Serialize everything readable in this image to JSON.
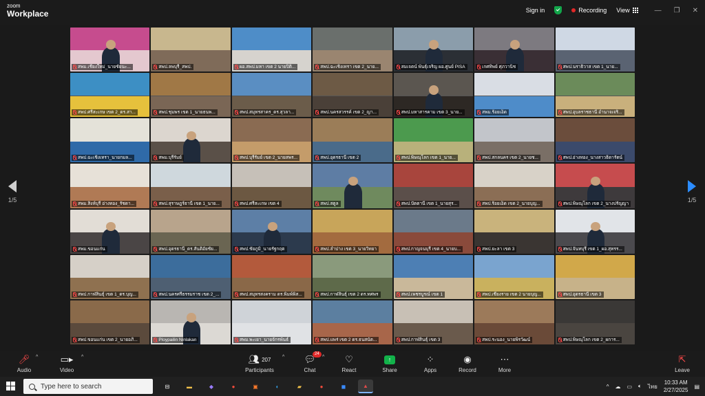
{
  "app": {
    "logo_line1": "zoom",
    "logo_line2": "Workplace"
  },
  "topbar": {
    "signin": "Sign in",
    "recording": "Recording",
    "view": "View"
  },
  "pager": {
    "left": "1/5",
    "right": "1/5"
  },
  "tiles": [
    {
      "name": "สพม.เชียงใหม่_นายชัยนะ...",
      "top": "#c64c8e",
      "bot": "#e4c8cf",
      "person": true
    },
    {
      "name": "สพป.ลพบุรี_สพป.",
      "top": "#c8b78e",
      "bot": "#7f6b59",
      "person": false
    },
    {
      "name": "ผอ.สพป.มหา เขต 2 นายปิติ...",
      "top": "#4e8dc8",
      "bot": "#d6d3ce",
      "person": false
    },
    {
      "name": "สพป.ฉะเชิงเทรา เขต 2_นาย...",
      "top": "#6a6f6c",
      "bot": "#9a8570",
      "person": false
    },
    {
      "name": "สมเจตน์ พันธุ์เจริญ ผอ.ศูนย์ PISA",
      "top": "#8b9dab",
      "bot": "#2b2f35",
      "person": true,
      "active": true
    },
    {
      "name": "เกศทิพย์ ศุภวานิช",
      "top": "#7d7a80",
      "bot": "#3a2f35",
      "person": true
    },
    {
      "name": "สพป.นราธิวาส เขต 1_นาย...",
      "top": "#cfd8e4",
      "bot": "#5a6372",
      "person": false
    },
    {
      "name": "สพป.ศรีสะเกษ เขต 2_ดร.สา...",
      "top": "#3d8fc4",
      "bot": "#e6c13c",
      "person": false
    },
    {
      "name": "สพป.ชุมพร เขต 1_นายธนพ...",
      "top": "#a07846",
      "bot": "#7a6655",
      "person": false
    },
    {
      "name": "สพป.สมุทรสาคร_ดร.สุวลา...",
      "top": "#5a8ec2",
      "bot": "#6b5c4a",
      "person": false
    },
    {
      "name": "สพป.นครสวรรค์ เขต 2_ญา...",
      "top": "#6d5a45",
      "bot": "#4a4038",
      "person": false
    },
    {
      "name": "สพป.มหาสารคาม เขต 3_นาย...",
      "top": "#5b5650",
      "bot": "#2d2824",
      "person": true
    },
    {
      "name": "สพม.ร้อยเอ็ด",
      "top": "#d9dde4",
      "bot": "#4e8cc9",
      "person": false
    },
    {
      "name": "สพป.อุบลราชธานี อำนาจเจริ...",
      "top": "#6b8b5a",
      "bot": "#c9b07c",
      "person": false
    },
    {
      "name": "สพป.ฉะเชิงเทรา_นายกมล...",
      "top": "#e4e2d9",
      "bot": "#2f6aa8",
      "person": false
    },
    {
      "name": "สพม.บุรีรัมย์",
      "top": "#dcd6cf",
      "bot": "#5a5048",
      "person": true
    },
    {
      "name": "สพป.บุรีรัมย์ เขต 2_นายสพร...",
      "top": "#8a6b52",
      "bot": "#c49c6a",
      "person": false
    },
    {
      "name": "สพป.อุดรธานี เขต 2",
      "top": "#9b7d58",
      "bot": "#4a6b8a",
      "person": false
    },
    {
      "name": "สพป.พิษณุโลก เขต 1_นาย...",
      "top": "#4c9a4e",
      "bot": "#b8b17b",
      "person": false
    },
    {
      "name": "สพป.สกลนคร เขต 2_นายช...",
      "top": "#c2c5ca",
      "bot": "#7a6f66",
      "person": false
    },
    {
      "name": "สพป.อ่างทอง_นางสาวธิดารัตน์",
      "top": "#6b4d3c",
      "bot": "#3b4a6b",
      "person": false
    },
    {
      "name": "สพม.สิงห์บุรี อ่างทอง_รัชดา...",
      "top": "#e7e1d8",
      "bot": "#b07a55",
      "person": false
    },
    {
      "name": "สพป.สุราษฎร์ธานี เขต 1_นาย...",
      "top": "#cfd8dd",
      "bot": "#7a5f4a",
      "person": false
    },
    {
      "name": "สพป.ศรีสะเกษ เขต 4",
      "top": "#c6c0b8",
      "bot": "#6c5842",
      "person": false
    },
    {
      "name": "สพป.สตูล",
      "top": "#5e7da4",
      "bot": "#6f8a5e",
      "person": true
    },
    {
      "name": "สพป.ปัตตานี เขต 1_นายสุร...",
      "top": "#a8453d",
      "bot": "#5b4f4a",
      "person": false
    },
    {
      "name": "สพป.ร้อยเอ็ด เขต 2_นายบุญ...",
      "top": "#d8d2c8",
      "bot": "#8b6e55",
      "person": false
    },
    {
      "name": "สพป.พิษณุโลก เขต 2_นางปรัญญา",
      "top": "#c64c4e",
      "bot": "#3e3a3c",
      "person": true
    },
    {
      "name": "สพม.ขอนแก่น",
      "top": "#e2ddd6",
      "bot": "#4a4545",
      "person": true
    },
    {
      "name": "สพป.อุดรธานี_ดร.สันติอัยชัย...",
      "top": "#b8a48c",
      "bot": "#6a6552",
      "person": false
    },
    {
      "name": "สพป.ชัยภูมิ_นายรัฐกฤต",
      "top": "#5d7fa6",
      "bot": "#2c3a4d",
      "person": true
    },
    {
      "name": "สพป.ลำปาง เขต 3_นายวิทยา",
      "top": "#c8a55a",
      "bot": "#a36b3f",
      "person": false
    },
    {
      "name": "สพป.กาญจนบุรี เขต 4_นายบ...",
      "top": "#6b7a8a",
      "bot": "#8a4a3b",
      "person": false
    },
    {
      "name": "สพป.ยะลา เขต 3",
      "top": "#c9b37c",
      "bot": "#3a3532",
      "person": false
    },
    {
      "name": "สพป.จันทบุรี เขต 1_ผอ.สุทรร...",
      "top": "#e1e4e8",
      "bot": "#4b4a4e",
      "person": true
    },
    {
      "name": "สพป.กาฬสินธุ์ เขต 1_ดร.บุญ...",
      "top": "#d6d0c8",
      "bot": "#8f7150",
      "person": false
    },
    {
      "name": "สพป.นครศรีธรรมราช เขต 2_...",
      "top": "#3c6d9c",
      "bot": "#4e5f72",
      "person": false
    },
    {
      "name": "สพป.สมุทรสงคราม ดร.พิมพ์พิส...",
      "top": "#b35a3c",
      "bot": "#8a6848",
      "person": false
    },
    {
      "name": "สพป.กาฬสินธุ์ เขต 2 ดร.ทศพร",
      "top": "#8a9a7c",
      "bot": "#5e6a4a",
      "person": false
    },
    {
      "name": "สพป.เพชรบูรณ์ เขต 1",
      "top": "#4d7fb4",
      "bot": "#c9b89a",
      "person": false
    },
    {
      "name": "สพป.เชียงราย เขต 2 นายบุญ...",
      "top": "#7aa4cf",
      "bot": "#c9b15e",
      "person": false
    },
    {
      "name": "สพป.อุดรธานี เขต 3",
      "top": "#d1a84a",
      "bot": "#c7b289",
      "person": false
    },
    {
      "name": "สพป.ขอนแก่น เขต 2_นายอภิ...",
      "top": "#8a6a4a",
      "bot": "#5b4a3c",
      "person": false
    },
    {
      "name": "Ploypailin Ninlakan",
      "top": "#b9b6b2",
      "bot": "#dcd9d4",
      "person": true
    },
    {
      "name": "สพม.พะเยา_นายจักรพันธ์",
      "top": "#cfd3d8",
      "bot": "#e0e2e5",
      "person": false
    },
    {
      "name": "สพป.แพร่ เขต 2 ดร.ธนสนัต...",
      "top": "#5c7fa0",
      "bot": "#a8664a",
      "person": false
    },
    {
      "name": "สพป.กาฬสินธุ์ เขต 3",
      "top": "#c8c0b5",
      "bot": "#6a5a4c",
      "person": false
    },
    {
      "name": "สพป.ระนอง_นายพิรวัฒน์",
      "top": "#9c7a5a",
      "bot": "#6a4a38",
      "person": false
    },
    {
      "name": "สพป.พิษณุโลก เขต 2_ผการ...",
      "top": "#3a3836",
      "bot": "#4a4540",
      "person": false
    }
  ],
  "toolbar": {
    "audio": "Audio",
    "video": "Video",
    "participants": "Participants",
    "participants_count": "207",
    "chat": "Chat",
    "chat_badge": "24",
    "react": "React",
    "share": "Share",
    "apps": "Apps",
    "record": "Record",
    "more": "More",
    "leave": "Leave"
  },
  "taskbar": {
    "search_placeholder": "Type here to search",
    "time": "10:33 AM",
    "date": "2/27/2025",
    "lang": "ไทย"
  },
  "colors": {
    "active_speaker": "#3fd46b",
    "recording": "#e02828",
    "share": "#12b24a",
    "nav_arrow": "#2b8cff"
  }
}
